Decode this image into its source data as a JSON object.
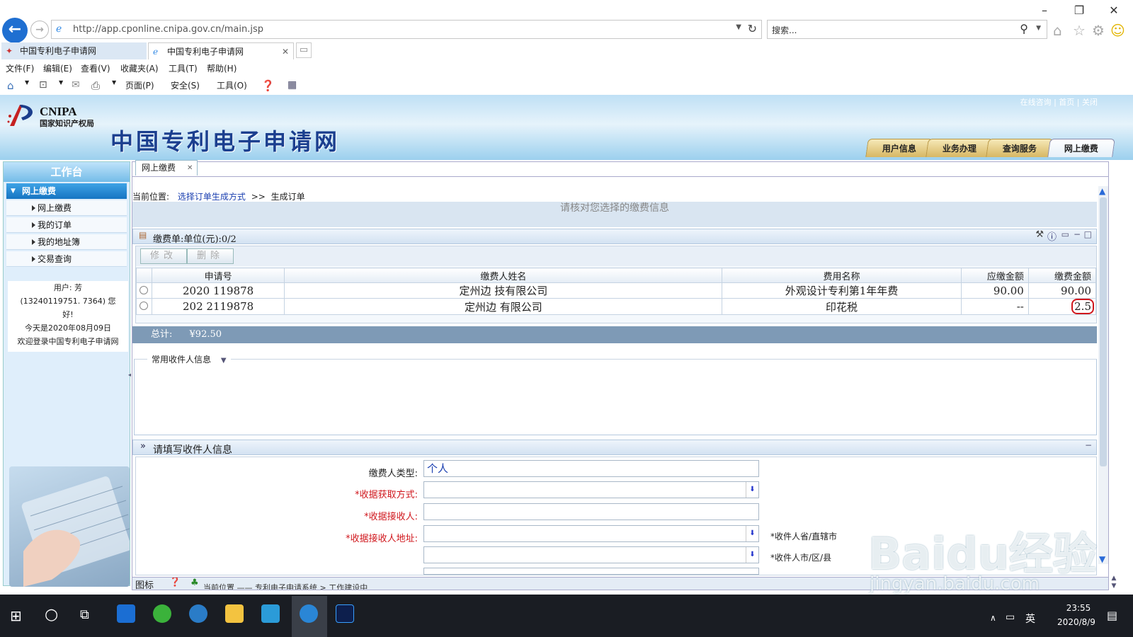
{
  "browser": {
    "url": "http://app.cponline.cnipa.gov.cn/main.jsp",
    "search_placeholder": "搜索...",
    "tabs": [
      {
        "label": "中国专利电子申请网"
      },
      {
        "label": "中国专利电子申请网"
      }
    ],
    "menu": [
      "文件(F)",
      "编辑(E)",
      "查看(V)",
      "收藏夹(A)",
      "工具(T)",
      "帮助(H)"
    ],
    "commands": [
      "页面(P)",
      "安全(S)",
      "工具(O)"
    ]
  },
  "header": {
    "logo_en": "CNIPA",
    "logo_cn": "国家知识产权局",
    "site_title": "中国专利电子申请网",
    "top_links": "在线咨询 | 首页 | 关闭",
    "main_tabs": [
      "用户信息",
      "业务办理",
      "查询服务",
      "网上缴费"
    ]
  },
  "sidebar": {
    "title": "工作台",
    "group": "网上缴费",
    "items": [
      "网上缴费",
      "我的订单",
      "我的地址簿",
      "交易查询"
    ],
    "user_line1": "用户:       芳",
    "user_line2": "(13240119751.    7364)  您",
    "user_line3": "好!",
    "date_line": "今天是2020年08月09日",
    "welcome": "欢迎登录中国专利电子申请网"
  },
  "content": {
    "tab_label": "网上缴费",
    "breadcrumb_prefix": "当前位置:",
    "breadcrumb_link": "选择订单生成方式",
    "breadcrumb_sep": ">>",
    "breadcrumb_current": "生成订单",
    "verify_notice": "请核对您选择的缴费信息",
    "fee_panel_title": "缴费单:单位(元):0/2",
    "btn_modify": "修改",
    "btn_delete": "删除",
    "columns": [
      "申请号",
      "缴费人姓名",
      "费用名称",
      "应缴金额",
      "缴费金额"
    ],
    "rows": [
      {
        "app_no": "2020      119878",
        "payer": "定州边      技有限公司",
        "fee": "外观设计专利第1年年费",
        "due": "90.00",
        "paid": "90.00"
      },
      {
        "app_no": "202      2119878",
        "payer": "定州边      有限公司",
        "fee": "印花税",
        "due": "--",
        "paid": "2.5"
      }
    ],
    "total_label": "总计:",
    "total_value": "¥92.50",
    "common_recipient": "常用收件人信息",
    "form_title": "请填写收件人信息",
    "form": {
      "payer_type_label": "缴费人类型:",
      "payer_type_value": "个人",
      "receipt_method_label": "*收据获取方式:",
      "receipt_receiver_label": "*收据接收人:",
      "receipt_address_label": "*收据接收人地址:",
      "province_label": "*收件人省/直辖市",
      "city_label": "*收件人市/区/县"
    },
    "status_icons_label": "图标",
    "status_text": "当前位置 —— 专利电子申请系统 > 工作建设中"
  },
  "taskbar": {
    "ime": "英",
    "time": "23:55",
    "date": "2020/8/9"
  },
  "watermark": {
    "line1": "Baidu经验",
    "line2": "jingyan.baidu.com"
  },
  "colors": {
    "accent": "#1a5cc8",
    "banner": "#9cd0ee",
    "tab_gold": "#d7b763",
    "red_highlight": "#d0171d",
    "taskbar": "#1a1d23"
  }
}
